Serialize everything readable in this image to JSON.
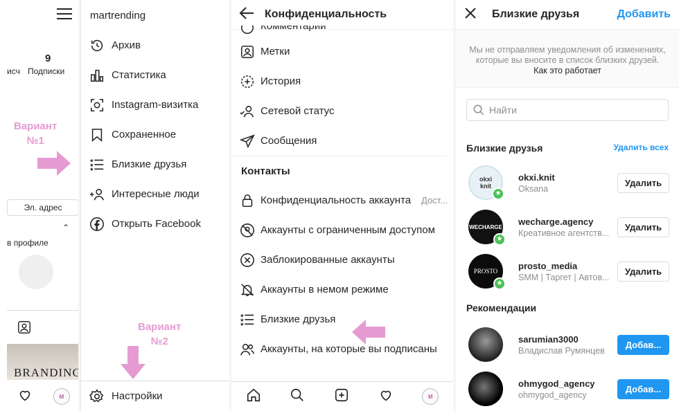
{
  "panel1": {
    "stat_count": "9",
    "stat_label": "Подписки",
    "stat_label_left": "исч",
    "variant_label": "Вариант\n№1",
    "email_button": "Эл. адрес",
    "in_profile": "в профиле",
    "branding_text": "BRANDING",
    "avatar_text": "M"
  },
  "panel2": {
    "username": "martrending",
    "menu": [
      {
        "label": "Архив",
        "icon": "archive-icon"
      },
      {
        "label": "Статистика",
        "icon": "stats-icon"
      },
      {
        "label": "Instagram-визитка",
        "icon": "nametag-icon"
      },
      {
        "label": "Сохраненное",
        "icon": "bookmark-icon"
      },
      {
        "label": "Близкие друзья",
        "icon": "close-friends-icon"
      },
      {
        "label": "Интересные люди",
        "icon": "discover-people-icon"
      },
      {
        "label": "Открыть Facebook",
        "icon": "facebook-icon"
      }
    ],
    "variant_label": "Вариант\n№2",
    "settings_label": "Настройки"
  },
  "panel3": {
    "title": "Конфиденциальность",
    "items_top": [
      {
        "label": "Комментарии",
        "icon": "comment-icon"
      },
      {
        "label": "Метки",
        "icon": "tag-icon"
      },
      {
        "label": "История",
        "icon": "story-icon"
      },
      {
        "label": "Сетевой статус",
        "icon": "activity-status-icon"
      },
      {
        "label": "Сообщения",
        "icon": "messages-icon"
      }
    ],
    "section_contacts": "Контакты",
    "items_contacts": [
      {
        "label": "Конфиденциальность аккаунта",
        "value": "Дост...",
        "icon": "lock-icon"
      },
      {
        "label": "Аккаунты с ограниченным доступом",
        "icon": "restricted-icon"
      },
      {
        "label": "Заблокированные аккаунты",
        "icon": "blocked-icon"
      },
      {
        "label": "Аккаунты в немом режиме",
        "icon": "muted-icon"
      },
      {
        "label": "Близкие друзья",
        "icon": "close-friends-icon"
      },
      {
        "label": "Аккаунты, на которые вы подписаны",
        "icon": "following-icon"
      }
    ],
    "avatar_text": "M"
  },
  "panel4": {
    "title": "Близкие друзья",
    "add_label": "Добавить",
    "notice_line1": "Мы не отправляем уведомления об изменениях,",
    "notice_line2": "которые вы вносите в список близких друзей.",
    "notice_link": "Как это работает",
    "search_placeholder": "Найти",
    "section_friends": "Близкие друзья",
    "remove_all": "Удалить всех",
    "friends": [
      {
        "username": "okxi.knit",
        "subtitle": "Oksana",
        "button": "Удалить",
        "avatar_text": "okxi knit"
      },
      {
        "username": "wecharge.agency",
        "subtitle": "Креативное агентств...",
        "button": "Удалить",
        "avatar_text": "WECHARGE"
      },
      {
        "username": "prosto_media",
        "subtitle": "SMM | Таргет | Автов...",
        "button": "Удалить",
        "avatar_text": "PROSTO"
      }
    ],
    "section_recommendations": "Рекомендации",
    "recommendations": [
      {
        "username": "sarumian3000",
        "subtitle": "Владислав Румянцев",
        "button": "Добав..."
      },
      {
        "username": "ohmygod_agency",
        "subtitle": "ohmygod_agency",
        "button": "Добав..."
      }
    ]
  },
  "colors": {
    "accent": "#1f96f0",
    "highlight": "#e59bd2",
    "star": "#4bc15a"
  }
}
